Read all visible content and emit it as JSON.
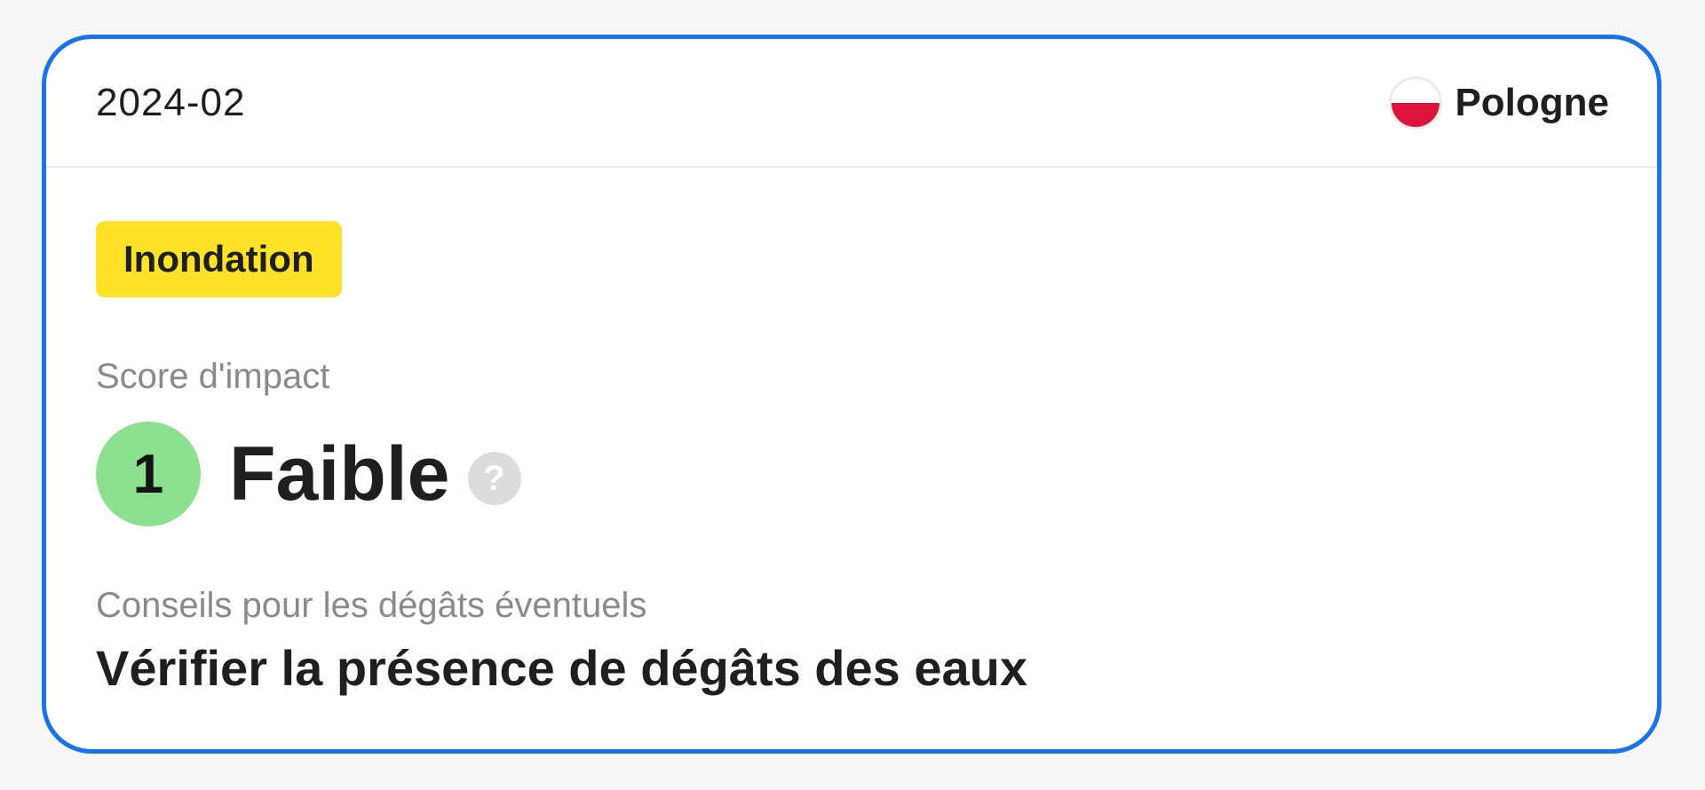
{
  "card": {
    "date": "2024-02",
    "country": {
      "name": "Pologne",
      "flag_icon": "poland-flag-icon",
      "flag_colors": [
        "#ffffff",
        "#dc143c"
      ]
    },
    "hazard_badge": {
      "label": "Inondation",
      "color": "#fee227"
    },
    "impact": {
      "label": "Score d'impact",
      "score": "1",
      "score_color": "#8de08f",
      "level": "Faible",
      "help_icon": "question-mark-icon",
      "help_glyph": "?"
    },
    "advice": {
      "label": "Conseils pour les dégâts éventuels",
      "text": "Vérifier la présence de dégâts des eaux"
    }
  },
  "colors": {
    "accent_border": "#1a73e8"
  }
}
